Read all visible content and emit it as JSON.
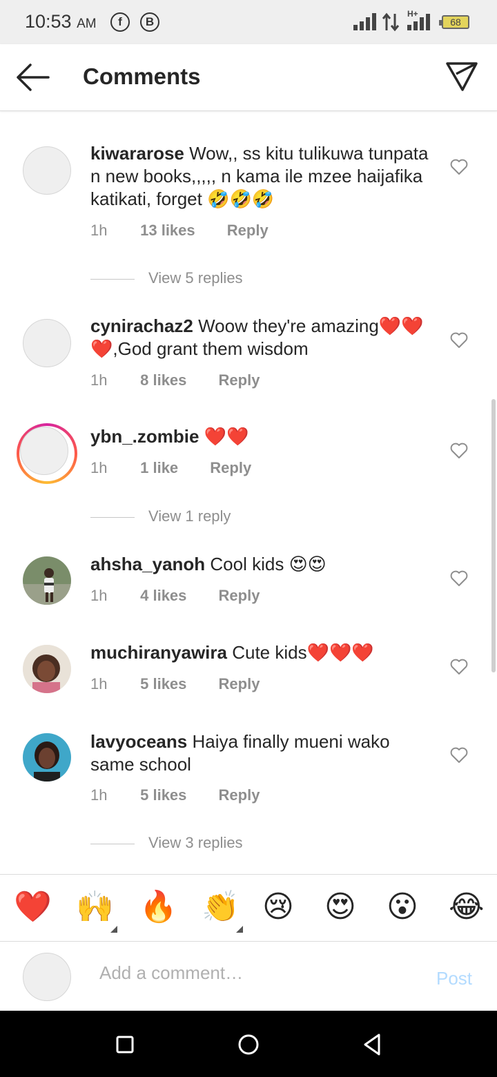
{
  "status": {
    "time": "10:53",
    "ampm": "AM",
    "notif_icons": [
      "facebook-icon",
      "b-icon"
    ],
    "network_label": "H+",
    "battery": "68"
  },
  "header": {
    "title": "Comments"
  },
  "comments": [
    {
      "username": "kiwararose",
      "text": "Wow,, ss kitu tulikuwa tunpata n new books,,,,, n kama ile mzee haijafika katikati, forget 🤣🤣🤣",
      "time": "1h",
      "likes": "13 likes",
      "reply": "Reply",
      "view_replies": "View 5 replies"
    },
    {
      "username": "cynirachaz2",
      "text": "Woow they're amazing❤️❤️❤️,God grant them wisdom",
      "time": "1h",
      "likes": "8 likes",
      "reply": "Reply"
    },
    {
      "username": "ybn_.zombie",
      "text": "❤️❤️",
      "time": "1h",
      "likes": "1 like",
      "reply": "Reply",
      "view_replies": "View 1 reply"
    },
    {
      "username": "ahsha_yanoh",
      "text": "Cool kids 😍😍",
      "time": "1h",
      "likes": "4 likes",
      "reply": "Reply"
    },
    {
      "username": "muchiranyawira",
      "text": "Cute kids❤️❤️❤️",
      "time": "1h",
      "likes": "5 likes",
      "reply": "Reply"
    },
    {
      "username": "lavyoceans",
      "text": "Haiya finally mueni wako same school",
      "time": "1h",
      "likes": "5 likes",
      "reply": "Reply",
      "view_replies": "View 3 replies"
    }
  ],
  "emoji_bar": [
    "❤️",
    "🙌",
    "🔥",
    "👏",
    "😢",
    "😍",
    "😮",
    "😂"
  ],
  "add_comment": {
    "placeholder": "Add a comment…",
    "post_label": "Post"
  },
  "colors": {
    "accent_disabled": "#b3dbff",
    "muted_text": "#8e8e8e"
  }
}
